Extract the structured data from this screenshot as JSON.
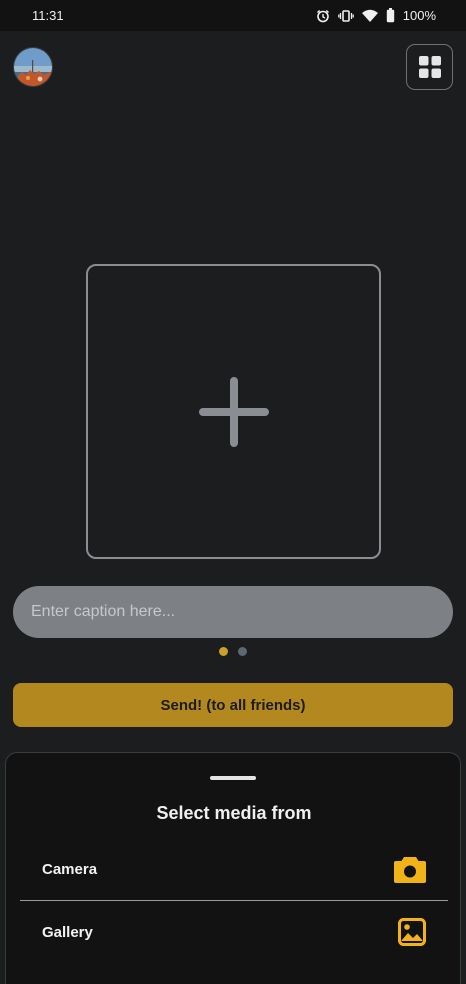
{
  "status_bar": {
    "time": "11:31",
    "battery": "100%",
    "icons": [
      "alarm-icon",
      "vibrate-icon",
      "wifi-icon",
      "battery-icon"
    ]
  },
  "header": {
    "avatar_icon": "profile-avatar",
    "grid_icon": "grid-icon"
  },
  "media_box": {
    "icon": "add-icon"
  },
  "caption": {
    "placeholder": "Enter caption here...",
    "value": ""
  },
  "pager": {
    "count": 2,
    "active_index": 0
  },
  "send_button": {
    "label": "Send! (to all friends)"
  },
  "sheet": {
    "title": "Select media from",
    "options": [
      {
        "label": "Camera",
        "icon": "camera-icon"
      },
      {
        "label": "Gallery",
        "icon": "gallery-icon"
      }
    ]
  },
  "colors": {
    "background": "#1b1d1f",
    "accent": "#b3891f",
    "icon_accent": "#f2b318",
    "sheet": "#121212",
    "caption_field": "#7d8185"
  }
}
